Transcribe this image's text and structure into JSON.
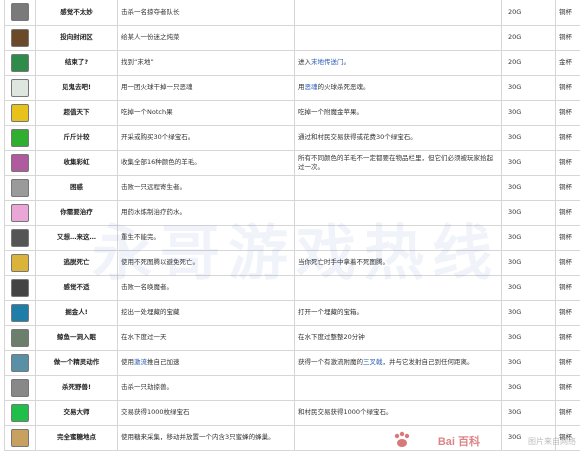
{
  "rows": [
    {
      "icon": "bow-icon",
      "color": "#7a7a7a",
      "name": "感觉不太妙",
      "cond": "击杀一名掠夺者队长",
      "info": "",
      "pts": "20G",
      "reward": "铜杯"
    },
    {
      "icon": "stew-icon",
      "color": "#6b4a2a",
      "name": "投向封闭区",
      "cond": "给某人一份迷之炖菜",
      "info": "",
      "pts": "20G",
      "reward": "铜杯"
    },
    {
      "icon": "compass-icon",
      "color": "#2e8b4a",
      "name": "结束了?",
      "cond": "找到“末地”",
      "info": "进入末地传送门。",
      "infoLink": "末地传送门",
      "pts": "20G",
      "reward": "金杯"
    },
    {
      "icon": "fire-charge-icon",
      "color": "#dfe6df",
      "name": "见鬼去吧!",
      "cond": "用一团火球干掉一只恶魂",
      "info": "用恶魂的火球杀死恶魂。",
      "infoLink": "恶魂",
      "pts": "30G",
      "reward": "铜杯"
    },
    {
      "icon": "golden-apple-icon",
      "color": "#e8c21c",
      "name": "超值天下",
      "cond": "吃掉一个Notch果",
      "info": "吃掉一个附魔金苹果。",
      "pts": "30G",
      "reward": "铜杯"
    },
    {
      "icon": "emerald-icon",
      "color": "#2fae2f",
      "name": "斤斤计较",
      "cond": "开采或购买30个绿宝石。",
      "info": "通过和村民交易获得或花费30个绿宝石。",
      "pts": "30G",
      "reward": "铜杯"
    },
    {
      "icon": "wool-icon",
      "color": "#b05aa0",
      "name": "收集彩虹",
      "cond": "收集全部16种颜色的羊毛。",
      "info": "所有不同颜色的羊毛不一定都要在物品栏里，但它们必须被玩家拾起过一次。",
      "pts": "30G",
      "reward": "铜杯"
    },
    {
      "icon": "arrow-icon",
      "color": "#9a9a9a",
      "name": "困惑",
      "cond": "击败一只远程寄生者。",
      "info": "",
      "pts": "30G",
      "reward": "铜杯"
    },
    {
      "icon": "potion-icon",
      "color": "#e9a6d6",
      "name": "你需要治疗",
      "cond": "用药水炼制治疗药水。",
      "info": "",
      "pts": "30G",
      "reward": "铜杯"
    },
    {
      "icon": "minecart-icon",
      "color": "#555555",
      "name": "又想…来这…",
      "cond": "重生不能完。",
      "info": "",
      "pts": "30G",
      "reward": "铜杯"
    },
    {
      "icon": "totem-icon",
      "color": "#d9b33a",
      "name": "逃脱死亡",
      "cond": "使用不死图腾以避免死亡。",
      "info": "当你死亡时手中拿着不死图腾。",
      "pts": "30G",
      "reward": "铜杯"
    },
    {
      "icon": "armor-stand-icon",
      "color": "#444444",
      "name": "感觉不适",
      "cond": "击败一名唤魔者。",
      "info": "",
      "pts": "30G",
      "reward": "铜杯"
    },
    {
      "icon": "heart-of-sea-icon",
      "color": "#1f7ea8",
      "name": "掘金人!",
      "cond": "挖出一处埋藏的宝藏",
      "info": "打开一个埋藏的宝箱。",
      "pts": "30G",
      "reward": "铜杯"
    },
    {
      "icon": "conduit-icon",
      "color": "#6c7e6c",
      "name": "鲸鱼一洞入眠",
      "cond": "在水下度过一天",
      "info": "在水下度过整整20分钟",
      "pts": "30G",
      "reward": "铜杯"
    },
    {
      "icon": "dolphin-icon",
      "color": "#5a8fa8",
      "name": "做一个精灵动作",
      "cond": "使用激流推自己加速",
      "info": "获得一个有激流附魔的三叉戟，并与它发射自己到任何距离。",
      "condLink": "激流",
      "infoLink": "三叉戟",
      "pts": "30G",
      "reward": "铜杯"
    },
    {
      "icon": "trident-icon",
      "color": "#888888",
      "name": "杀死野兽!",
      "cond": "击杀一只劫掠兽。",
      "info": "",
      "pts": "30G",
      "reward": "铜杯"
    },
    {
      "icon": "emerald-block-icon",
      "color": "#1fbf4a",
      "name": "交易大师",
      "cond": "交易获得1000枚绿宝石",
      "info": "和村民交易获得1000个绿宝石。",
      "pts": "30G",
      "reward": "铜杯"
    },
    {
      "icon": "scaffold-icon",
      "color": "#c8a060",
      "name": "完全蜜糖地点",
      "cond": "使用糖来采集，移动并放置一个内含3只蜜蜂的蜂巢。",
      "info": "",
      "pts": "30G",
      "reward": "铜杯"
    }
  ],
  "watermark": "永哥游戏热线",
  "baidu_logo": "Bai 百科",
  "baidu_tag": "图片来自网络"
}
